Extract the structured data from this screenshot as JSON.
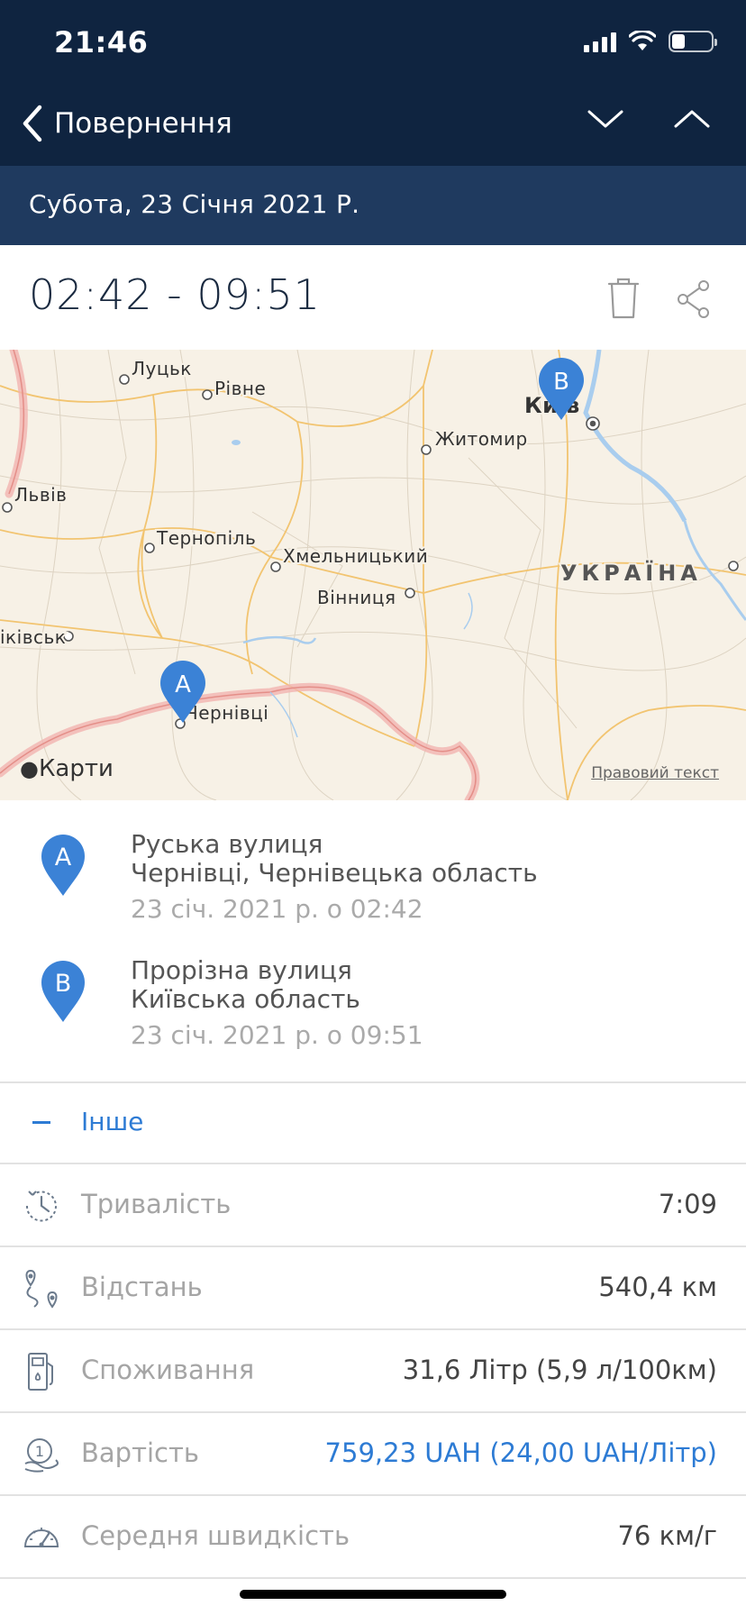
{
  "status": {
    "time": "21:46"
  },
  "nav": {
    "back_label": "Повернення"
  },
  "date_bar": {
    "text": "Субота, 23 Січня 2021 Р."
  },
  "trip": {
    "time_range": "02:42 - 09:51"
  },
  "map": {
    "brand": "Карти",
    "legal": "Правовий текст",
    "country_label": "УКРАЇНА",
    "cities": {
      "lutsk": "Луцьк",
      "rivne": "Рівне",
      "kyiv": "Київ",
      "zhytomyr": "Житомир",
      "lviv": "Львів",
      "ternopil": "Тернопіль",
      "khmelnytskyi": "Хмельницький",
      "vinnytsia": "Вінниця",
      "ivano_frankivsk": "іківськ",
      "chernivtsi": "Чернівці"
    },
    "pin_a": "A",
    "pin_b": "B"
  },
  "stops": [
    {
      "letter": "A",
      "street": "Руська вулиця",
      "region": "Чернівці, Чернівецька область",
      "time": "23 січ. 2021 р. о 02:42"
    },
    {
      "letter": "B",
      "street": "Прорізна вулиця",
      "region": "Київська область",
      "time": "23 січ. 2021 р. о 09:51"
    }
  ],
  "other": {
    "label": "Інше"
  },
  "stats": [
    {
      "label": "Тривалість",
      "value": "7:09",
      "icon": "clock-icon"
    },
    {
      "label": "Відстань",
      "value": "540,4 км",
      "icon": "route-icon"
    },
    {
      "label": "Споживання",
      "value": "31,6 Літр (5,9 л/100км)",
      "icon": "fuel-icon"
    },
    {
      "label": "Вартість",
      "value": "759,23 UAH (24,00 UAH/Літр)",
      "icon": "cost-icon"
    },
    {
      "label": "Середня швидкість",
      "value": "76 км/г",
      "icon": "speedometer-icon"
    }
  ],
  "colors": {
    "header": "#0f2440",
    "date_bar": "#1f3a5f",
    "accent": "#2d7bd4",
    "pin": "#3b82d6"
  }
}
